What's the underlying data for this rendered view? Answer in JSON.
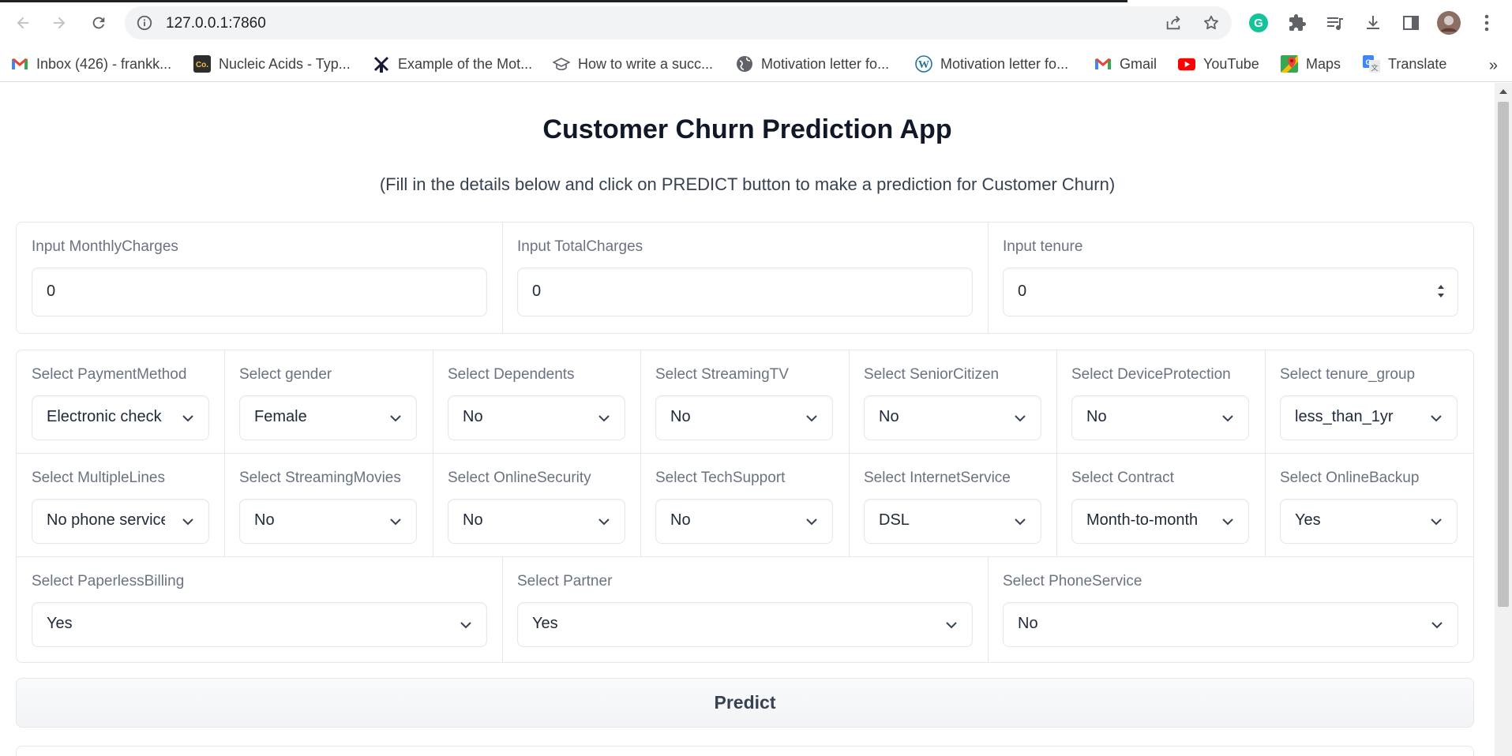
{
  "browser": {
    "url": "127.0.0.1:7860",
    "bookmarks": [
      {
        "label": "Inbox (426) - frankk...",
        "icon": "gmail-icon"
      },
      {
        "label": "Nucleic Acids - Typ...",
        "icon": "course-icon"
      },
      {
        "label": "Example of the Mot...",
        "icon": "windmill-icon"
      },
      {
        "label": "How to write a succ...",
        "icon": "graduation-cap-icon"
      },
      {
        "label": "Motivation letter fo...",
        "icon": "globe-icon"
      },
      {
        "label": "Motivation letter fo...",
        "icon": "wordpress-icon"
      },
      {
        "label": "Gmail",
        "icon": "gmail-icon"
      },
      {
        "label": "YouTube",
        "icon": "youtube-icon"
      },
      {
        "label": "Maps",
        "icon": "maps-icon"
      },
      {
        "label": "Translate",
        "icon": "translate-icon"
      }
    ],
    "more": "»"
  },
  "app": {
    "title": "Customer Churn Prediction App",
    "subtitle": "(Fill in the details below and click on PREDICT button to make a prediction for Customer Churn)",
    "numeric_inputs": [
      {
        "label": "Input MonthlyCharges",
        "value": "0"
      },
      {
        "label": "Input TotalCharges",
        "value": "0"
      },
      {
        "label": "Input tenure",
        "value": "0"
      }
    ],
    "dropdown_rows": [
      [
        {
          "label": "Select PaymentMethod",
          "value": "Electronic check"
        },
        {
          "label": "Select gender",
          "value": "Female"
        },
        {
          "label": "Select Dependents",
          "value": "No"
        },
        {
          "label": "Select StreamingTV",
          "value": "No"
        },
        {
          "label": "Select SeniorCitizen",
          "value": "No"
        },
        {
          "label": "Select DeviceProtection",
          "value": "No"
        },
        {
          "label": "Select tenure_group",
          "value": "less_than_1yr"
        }
      ],
      [
        {
          "label": "Select MultipleLines",
          "value": "No phone service"
        },
        {
          "label": "Select StreamingMovies",
          "value": "No"
        },
        {
          "label": "Select OnlineSecurity",
          "value": "No"
        },
        {
          "label": "Select TechSupport",
          "value": "No"
        },
        {
          "label": "Select InternetService",
          "value": "DSL"
        },
        {
          "label": "Select Contract",
          "value": "Month-to-month"
        },
        {
          "label": "Select OnlineBackup",
          "value": "Yes"
        }
      ],
      [
        {
          "label": "Select PaperlessBilling",
          "value": "Yes"
        },
        {
          "label": "Select Partner",
          "value": "Yes"
        },
        {
          "label": "Select PhoneService",
          "value": "No"
        }
      ]
    ],
    "predict_label": "Predict"
  }
}
